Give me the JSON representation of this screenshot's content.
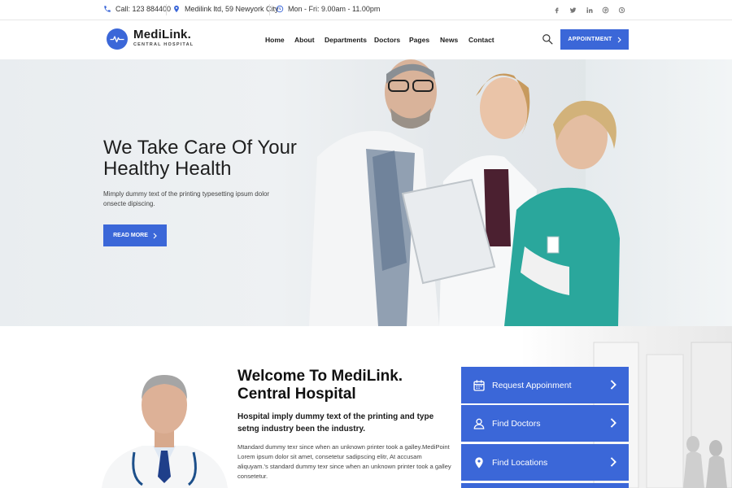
{
  "topbar": {
    "phone": "Call: 123 884400",
    "address": "Medilink ltd, 59 Newyork City",
    "hours": "Mon - Fri: 9.00am - 11.00pm",
    "socials": [
      "facebook-icon",
      "twitter-icon",
      "linkedin-icon",
      "pinterest-icon",
      "skype-icon"
    ]
  },
  "brand": {
    "name": "MediLink.",
    "tagline": "CENTRAL HOSPITAL",
    "color": "#3b67d8"
  },
  "nav": {
    "items": [
      "Home",
      "About",
      "Departments",
      "Doctors",
      "Pages",
      "News",
      "Contact"
    ],
    "cta": "APPOINTMENT"
  },
  "hero": {
    "title_line1": "We Take Care Of Your",
    "title_line2": "Healthy Health",
    "text": "Mimply dummy text of the printing typesetting ipsum dolor onsecte dipiscing.",
    "button": "READ MORE"
  },
  "welcome": {
    "title_line1": "Welcome To MediLink.",
    "title_line2": "Central Hospital",
    "lead": "Hospital imply dummy text of the printing and type setng industry been the industry.",
    "body": "Mtandard dummy texr since when an unknown printer took a galley.MediPoint Lorem ipsum dolor sit amet, consetetur sadipscing elitr, At accusam aliquyam.'s standard dummy texr since when an unknown printer took a galley consetetur."
  },
  "quick_links": [
    {
      "label": "Request Appoinment",
      "icon": "calendar-icon"
    },
    {
      "label": "Find Doctors",
      "icon": "user-icon"
    },
    {
      "label": "Find Locations",
      "icon": "location-pin-icon"
    }
  ]
}
